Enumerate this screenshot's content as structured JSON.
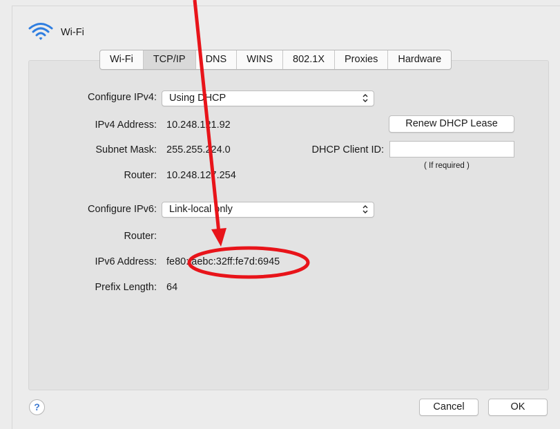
{
  "window": {
    "title": "Wi-Fi",
    "icon": "wifi-icon",
    "accent": "#2f7ee0"
  },
  "tabs": [
    "Wi-Fi",
    "TCP/IP",
    "DNS",
    "WINS",
    "802.1X",
    "Proxies",
    "Hardware"
  ],
  "active_tab": "TCP/IP",
  "ipv4": {
    "configure_label": "Configure IPv4:",
    "configure_value": "Using DHCP",
    "address_label": "IPv4 Address:",
    "address_value": "10.248.121.92",
    "subnet_label": "Subnet Mask:",
    "subnet_value": "255.255.224.0",
    "router_label": "Router:",
    "router_value": "10.248.127.254",
    "renew_button": "Renew DHCP Lease",
    "client_id_label": "DHCP Client ID:",
    "client_id_value": "",
    "client_id_hint": "( If required )"
  },
  "ipv6": {
    "configure_label": "Configure IPv6:",
    "configure_value": "Link-local only",
    "router_label": "Router:",
    "router_value": "",
    "address_label": "IPv6 Address:",
    "address_value": "fe80::aebc:32ff:fe7d:6945",
    "prefix_label": "Prefix Length:",
    "prefix_value": "64"
  },
  "footer": {
    "help": "?",
    "cancel": "Cancel",
    "ok": "OK"
  },
  "annotation": {
    "color": "#e8141a"
  }
}
